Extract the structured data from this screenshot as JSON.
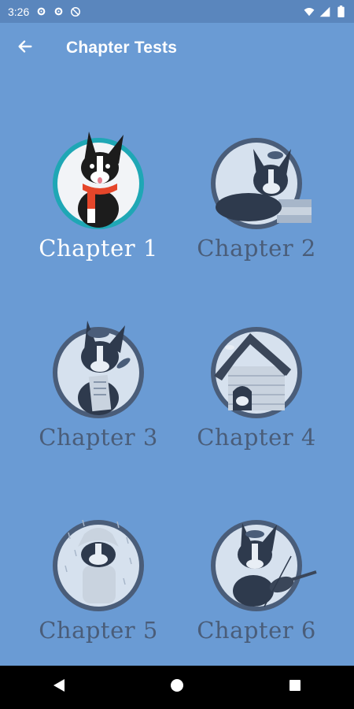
{
  "status_bar": {
    "time": "3:26",
    "left_icons": [
      "settings-icon",
      "settings-icon",
      "sync-off-icon"
    ],
    "right_icons": [
      "wifi-icon",
      "signal-icon",
      "battery-icon"
    ]
  },
  "app_bar": {
    "title": "Chapter Tests",
    "back_icon": "arrow-back-icon"
  },
  "chapters": [
    {
      "label": "Chapter 1",
      "active": true
    },
    {
      "label": "Chapter 2",
      "active": false
    },
    {
      "label": "Chapter 3",
      "active": false
    },
    {
      "label": "Chapter 4",
      "active": false
    },
    {
      "label": "Chapter 5",
      "active": false
    },
    {
      "label": "Chapter 6",
      "active": false
    }
  ],
  "nav_bar": {
    "icons": [
      "back-triangle-icon",
      "home-circle-icon",
      "recents-square-icon"
    ]
  },
  "colors": {
    "background": "#6A9BD4",
    "status_bar": "#5A86BD",
    "active_label": "#FFFFFF",
    "inactive_label": "#4A5D79",
    "active_ring": "#1FA7B5"
  }
}
